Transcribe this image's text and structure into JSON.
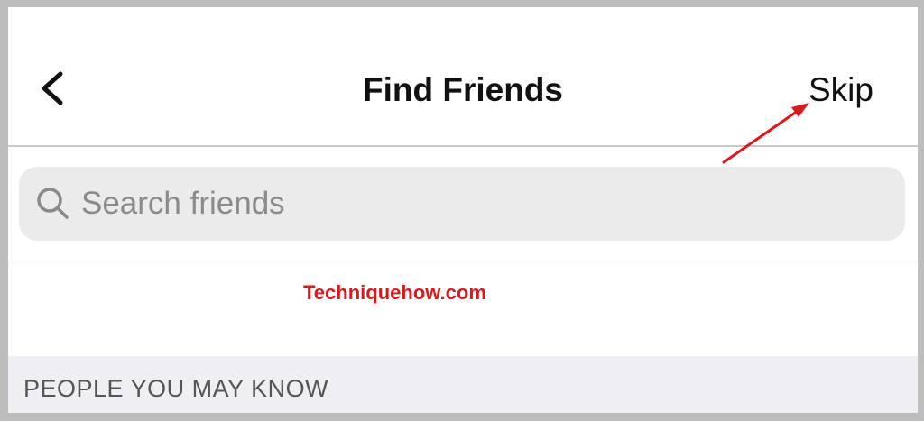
{
  "header": {
    "back_icon": "chevron-left-icon",
    "title": "Find Friends",
    "skip_label": "Skip"
  },
  "search": {
    "icon": "search-icon",
    "placeholder": "Search friends"
  },
  "watermark": {
    "text": "Techniquehow.com",
    "color": "#e0161b"
  },
  "section": {
    "label": "PEOPLE YOU MAY KNOW"
  },
  "annotation": {
    "arrow_color": "#e0161b",
    "points_to": "Skip"
  }
}
